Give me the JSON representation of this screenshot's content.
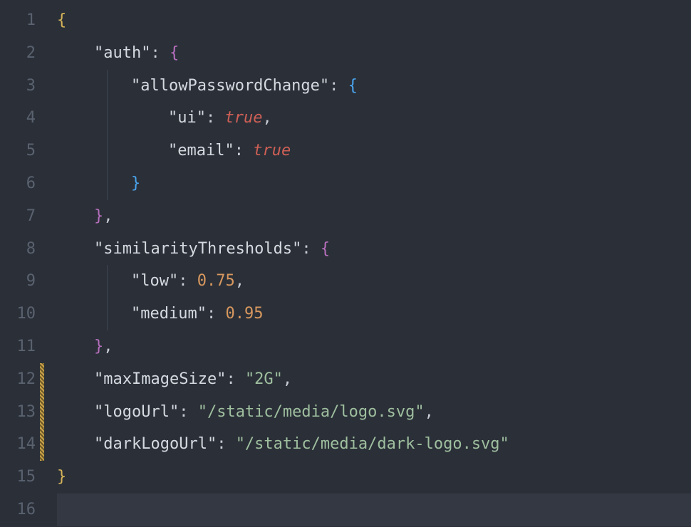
{
  "lines": {
    "n1": "1",
    "n2": "2",
    "n3": "3",
    "n4": "4",
    "n5": "5",
    "n6": "6",
    "n7": "7",
    "n8": "8",
    "n9": "9",
    "n10": "10",
    "n11": "11",
    "n12": "12",
    "n13": "13",
    "n14": "14",
    "n15": "15",
    "n16": "16"
  },
  "tok": {
    "obrace": "{",
    "cbrace": "}",
    "colon": ":",
    "comma": ",",
    "sp": " ",
    "k_auth": "\"auth\"",
    "k_allowPasswordChange": "\"allowPasswordChange\"",
    "k_ui": "\"ui\"",
    "k_email": "\"email\"",
    "k_similarityThresholds": "\"similarityThresholds\"",
    "k_low": "\"low\"",
    "k_medium": "\"medium\"",
    "k_maxImageSize": "\"maxImageSize\"",
    "k_logoUrl": "\"logoUrl\"",
    "k_darkLogoUrl": "\"darkLogoUrl\"",
    "v_true": "true",
    "v_075": "0.75",
    "v_095": "0.95",
    "v_2g": "\"2G\"",
    "v_logo": "\"/static/media/logo.svg\"",
    "v_darklogo": "\"/static/media/dark-logo.svg\""
  }
}
